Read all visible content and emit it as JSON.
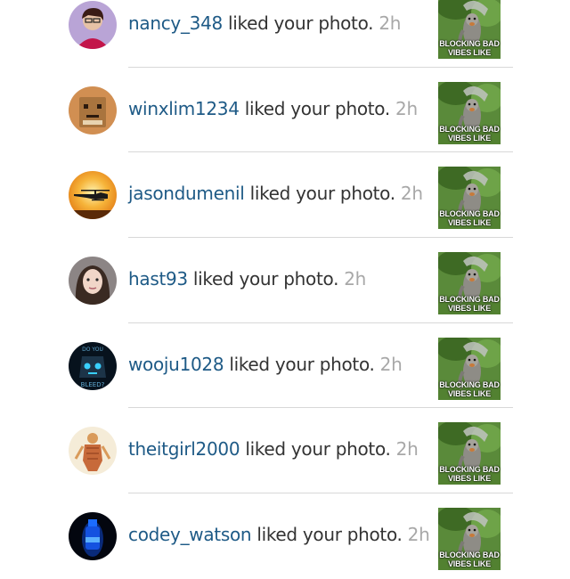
{
  "notifications": [
    {
      "username": "nancy_348",
      "action": "liked your photo.",
      "time": "2h",
      "avatar": "avatar-portrait-purple",
      "avatar_color": "#7a4fa8"
    },
    {
      "username": "winxlim1234",
      "action": "liked your photo.",
      "time": "2h",
      "avatar": "avatar-cardboard-robot",
      "avatar_color": "#c98a4a"
    },
    {
      "username": "jasondumenil",
      "action": "liked your photo.",
      "time": "2h",
      "avatar": "avatar-helicopter-sunset",
      "avatar_color": "#f0a020"
    },
    {
      "username": "hast93",
      "action": "liked your photo.",
      "time": "2h",
      "avatar": "avatar-portrait-selfie",
      "avatar_color": "#6a6060"
    },
    {
      "username": "wooju1028",
      "action": "liked your photo.",
      "time": "2h",
      "avatar": "avatar-robot-dark",
      "avatar_color": "#0a1a2a"
    },
    {
      "username": "theitgirl2000",
      "action": "liked your photo.",
      "time": "2h",
      "avatar": "avatar-anatomy-drawing",
      "avatar_color": "#e8c89a"
    },
    {
      "username": "codey_watson",
      "action": "liked your photo.",
      "time": "2h",
      "avatar": "avatar-blue-glow",
      "avatar_color": "#0b1530"
    }
  ],
  "thumbnail": {
    "caption_line1": "BLOCKING BAD",
    "caption_line2": "VIBES LIKE",
    "background_color": "#5a8a3a"
  }
}
